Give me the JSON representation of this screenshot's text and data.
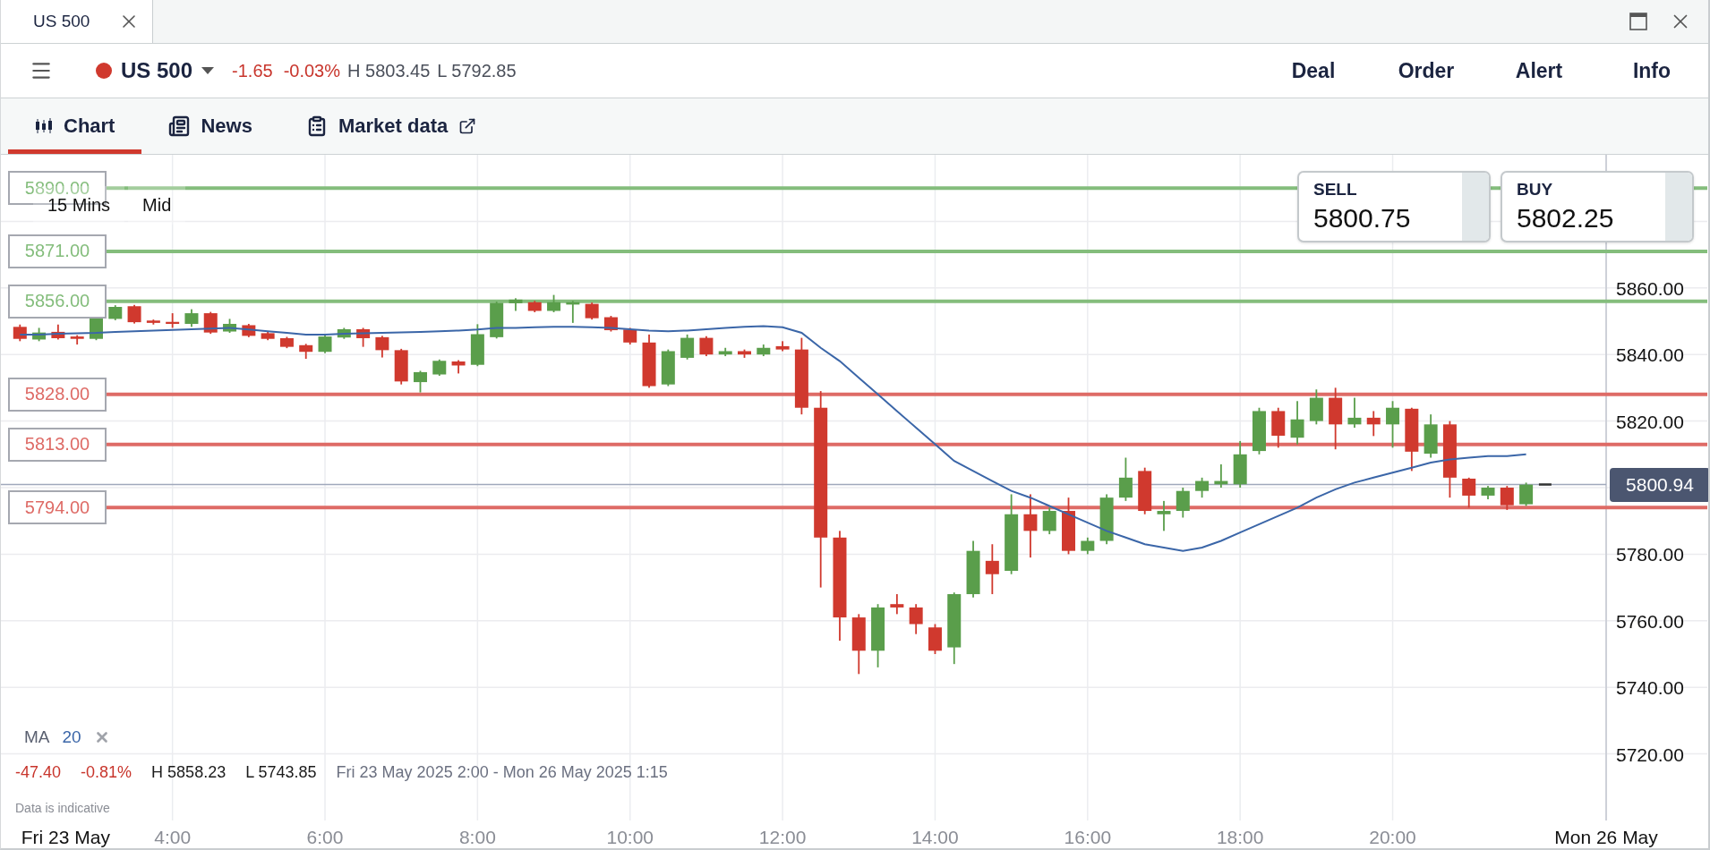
{
  "window": {
    "tab_title": "US 500"
  },
  "instrument": {
    "name": "US 500",
    "change": "-1.65",
    "change_pct": "-0.03%",
    "high": "H 5803.45",
    "low": "L 5792.85"
  },
  "actions": [
    "Deal",
    "Order",
    "Alert",
    "Info"
  ],
  "tabs": [
    {
      "label": "Chart",
      "selected": true,
      "kind": "chart",
      "external": false
    },
    {
      "label": "News",
      "selected": false,
      "kind": "news",
      "external": false
    },
    {
      "label": "Market data",
      "selected": false,
      "kind": "market",
      "external": true
    }
  ],
  "chart": {
    "interval": "15 Mins",
    "price_type": "Mid",
    "sell": {
      "label": "SELL",
      "price": "5800.75"
    },
    "buy": {
      "label": "BUY",
      "price": "5802.25"
    },
    "indicator_name": "MA",
    "stats": {
      "change": "-47.40",
      "change_pct": "-0.81%",
      "high": "H 5858.23",
      "low": "L 5743.85",
      "range": "Fri 23 May 2025 2:00 - Mon 26 May 2025 1:15"
    },
    "disclaimer": "Data is indicative",
    "chart_data": {
      "type": "candlestick",
      "grid": true,
      "xlim": [
        1.75,
        22.8
      ],
      "ylim": [
        5700,
        5900
      ],
      "yticks": [
        {
          "value": 5720,
          "label": "5720.00"
        },
        {
          "value": 5740,
          "label": "5740.00"
        },
        {
          "value": 5760,
          "label": "5760.00"
        },
        {
          "value": 5780,
          "label": "5780.00"
        },
        {
          "value": 5820,
          "label": "5820.00"
        },
        {
          "value": 5840,
          "label": "5840.00"
        },
        {
          "value": 5860,
          "label": "5860.00"
        }
      ],
      "xticks": [
        {
          "value": 2.6,
          "label": "Fri 23 May"
        },
        {
          "value": 4,
          "label": "4:00"
        },
        {
          "value": 6,
          "label": "6:00"
        },
        {
          "value": 8,
          "label": "8:00"
        },
        {
          "value": 10,
          "label": "10:00"
        },
        {
          "value": 12,
          "label": "12:00"
        },
        {
          "value": 14,
          "label": "14:00"
        },
        {
          "value": 16,
          "label": "16:00"
        },
        {
          "value": 18,
          "label": "18:00"
        },
        {
          "value": 20,
          "label": "20:00"
        },
        {
          "value": 22.8,
          "label": "Mon 26 May"
        }
      ],
      "x": [
        2,
        2.25,
        2.5,
        2.75,
        3,
        3.25,
        3.5,
        3.75,
        4,
        4.25,
        4.5,
        4.75,
        5,
        5.25,
        5.5,
        5.75,
        6,
        6.25,
        6.5,
        6.75,
        7,
        7.25,
        7.5,
        7.75,
        8,
        8.25,
        8.5,
        8.75,
        9,
        9.25,
        9.5,
        9.75,
        10,
        10.25,
        10.5,
        10.75,
        11,
        11.25,
        11.5,
        11.75,
        12,
        12.25,
        12.5,
        12.75,
        13,
        13.25,
        13.5,
        13.75,
        14,
        14.25,
        14.5,
        14.75,
        15,
        15.25,
        15.5,
        15.75,
        16,
        16.25,
        16.5,
        16.75,
        17,
        17.25,
        17.5,
        17.75,
        18,
        18.25,
        18.5,
        18.75,
        19,
        19.25,
        19.5,
        19.75,
        20,
        20.25,
        20.5,
        20.75,
        21,
        21.25,
        21.5,
        21.75
      ],
      "ohlc": [
        [
          5848.3,
          5849,
          5844,
          5844.7
        ],
        [
          5844.5,
          5848,
          5844,
          5846.6
        ],
        [
          5846.8,
          5849,
          5844.5,
          5844.9
        ],
        [
          5845.4,
          5845.8,
          5843,
          5844.7
        ],
        [
          5844.7,
          5851.3,
          5844.3,
          5851
        ],
        [
          5850.7,
          5854.8,
          5850.3,
          5854.3
        ],
        [
          5854.5,
          5854.9,
          5849.3,
          5849.7
        ],
        [
          5850.2,
          5850.5,
          5849,
          5849.5
        ],
        [
          5849.8,
          5852.4,
          5848,
          5849.2
        ],
        [
          5849.2,
          5853.6,
          5848.3,
          5852.4
        ],
        [
          5852.4,
          5852.8,
          5846.2,
          5846.6
        ],
        [
          5846.9,
          5850.7,
          5846.5,
          5849.2
        ],
        [
          5848.8,
          5849.2,
          5845.2,
          5845.6
        ],
        [
          5846.4,
          5846.8,
          5844.3,
          5844.7
        ],
        [
          5844.9,
          5845.3,
          5841.9,
          5842.3
        ],
        [
          5842.8,
          5843.2,
          5838.7,
          5840.8
        ],
        [
          5840.8,
          5845.8,
          5840.4,
          5845.4
        ],
        [
          5845.1,
          5848,
          5844.7,
          5847.6
        ],
        [
          5847.6,
          5848,
          5842.3,
          5844.9
        ],
        [
          5845.2,
          5845.6,
          5839.1,
          5841.3
        ],
        [
          5841.3,
          5841.7,
          5831,
          5831.9
        ],
        [
          5831.7,
          5835.1,
          5828.6,
          5834.7
        ],
        [
          5834,
          5838.5,
          5833.6,
          5838.1
        ],
        [
          5837.9,
          5838.3,
          5834.3,
          5836.7
        ],
        [
          5836.9,
          5849.1,
          5836.5,
          5846.1
        ],
        [
          5845.2,
          5855.9,
          5844.8,
          5855.5
        ],
        [
          5855.4,
          5856.9,
          5853.1,
          5856.5
        ],
        [
          5855.7,
          5856.1,
          5852.7,
          5853.1
        ],
        [
          5853.1,
          5857.9,
          5852.7,
          5855.7
        ],
        [
          5855,
          5856.1,
          5849.5,
          5855.7
        ],
        [
          5855.2,
          5855.6,
          5850.5,
          5850.9
        ],
        [
          5851.2,
          5851.6,
          5846.9,
          5847.3
        ],
        [
          5847.5,
          5848,
          5843,
          5843.6
        ],
        [
          5843.6,
          5846,
          5830,
          5830.5
        ],
        [
          5831,
          5841.5,
          5830.5,
          5841
        ],
        [
          5839,
          5846,
          5838.5,
          5845
        ],
        [
          5845,
          5845.5,
          5839.5,
          5840
        ],
        [
          5840,
          5842,
          5839.5,
          5841
        ],
        [
          5841,
          5841.5,
          5839,
          5840
        ],
        [
          5840,
          5843,
          5839.5,
          5842
        ],
        [
          5842.5,
          5844,
          5841,
          5841.5
        ],
        [
          5841.5,
          5845,
          5822,
          5824
        ],
        [
          5824,
          5829,
          5770,
          5785
        ],
        [
          5785,
          5787,
          5754,
          5761
        ],
        [
          5761,
          5762,
          5744,
          5751
        ],
        [
          5751,
          5765,
          5746,
          5764
        ],
        [
          5765,
          5768,
          5762,
          5764
        ],
        [
          5764,
          5765,
          5756,
          5759
        ],
        [
          5758,
          5759,
          5750,
          5751
        ],
        [
          5752,
          5768.5,
          5747,
          5768
        ],
        [
          5768,
          5784,
          5767,
          5781
        ],
        [
          5778,
          5783,
          5768,
          5774
        ],
        [
          5775,
          5798,
          5774,
          5792
        ],
        [
          5792,
          5798,
          5779,
          5787
        ],
        [
          5787,
          5794,
          5786,
          5793
        ],
        [
          5793,
          5797,
          5780,
          5781
        ],
        [
          5781,
          5785,
          5780,
          5784
        ],
        [
          5784,
          5798,
          5783,
          5797
        ],
        [
          5797,
          5809,
          5796,
          5803
        ],
        [
          5805,
          5806,
          5792,
          5793
        ],
        [
          5792,
          5796,
          5787,
          5793
        ],
        [
          5793,
          5800,
          5791,
          5799
        ],
        [
          5799,
          5803,
          5797,
          5802
        ],
        [
          5801,
          5807,
          5800,
          5802
        ],
        [
          5801,
          5814,
          5800,
          5810
        ],
        [
          5811,
          5824,
          5810,
          5823
        ],
        [
          5823,
          5824,
          5812,
          5815.6
        ],
        [
          5815,
          5826,
          5813,
          5820.5
        ],
        [
          5820,
          5829.5,
          5819,
          5827
        ],
        [
          5827,
          5830,
          5811.5,
          5819
        ],
        [
          5819,
          5827,
          5818,
          5821
        ],
        [
          5821,
          5823,
          5815.5,
          5819
        ],
        [
          5819,
          5826,
          5812,
          5824
        ],
        [
          5823.7,
          5824,
          5805,
          5810.8
        ],
        [
          5810.2,
          5822,
          5809,
          5819
        ],
        [
          5819,
          5820,
          5797,
          5803
        ],
        [
          5802.7,
          5803,
          5794,
          5797.6
        ],
        [
          5797.6,
          5800.5,
          5796.5,
          5800
        ],
        [
          5800,
          5800.5,
          5793.3,
          5794.7
        ],
        [
          5795,
          5801.5,
          5794.5,
          5800.9
        ]
      ],
      "series": [
        {
          "name": "20",
          "type": "line",
          "color": "#3b66a8",
          "values": [
            5846,
            5846,
            5846.2,
            5846.4,
            5846.5,
            5846.8,
            5847,
            5847.2,
            5847.4,
            5847.6,
            5847.8,
            5848,
            5847.5,
            5847,
            5846.5,
            5846,
            5846,
            5846.2,
            5846.4,
            5846.5,
            5846.6,
            5846.8,
            5847,
            5847.2,
            5847.5,
            5848,
            5848,
            5848.2,
            5848.3,
            5848.3,
            5848.2,
            5848,
            5847.6,
            5847.2,
            5847,
            5847.2,
            5847.6,
            5848,
            5848.3,
            5848.5,
            5848.2,
            5846.5,
            5842,
            5838,
            5833,
            5828,
            5823,
            5818,
            5813,
            5808,
            5805,
            5802,
            5799,
            5797,
            5794.5,
            5792,
            5789.5,
            5787,
            5785,
            5783,
            5782,
            5781,
            5782,
            5784,
            5786.5,
            5789,
            5791.5,
            5794,
            5797,
            5799.5,
            5801.5,
            5803,
            5804.5,
            5806,
            5807.5,
            5808.5,
            5809,
            5809.5,
            5809.5,
            5810
          ]
        }
      ],
      "ref_lines": [
        {
          "axis": "y",
          "value": 5890,
          "label": "5890.00",
          "color": "#84bd7c"
        },
        {
          "axis": "y",
          "value": 5871,
          "label": "5871.00",
          "color": "#84bd7c"
        },
        {
          "axis": "y",
          "value": 5856,
          "label": "5856.00",
          "color": "#84bd7c"
        },
        {
          "axis": "y",
          "value": 5828,
          "label": "5828.00",
          "color": "#de6b66"
        },
        {
          "axis": "y",
          "value": 5813,
          "label": "5813.00",
          "color": "#de6b66"
        },
        {
          "axis": "y",
          "value": 5794,
          "label": "5794.00",
          "color": "#de6b66"
        },
        {
          "axis": "y",
          "value": 5800.94,
          "color": "#a0a8bb"
        }
      ],
      "annotations": [
        "5800.94"
      ]
    }
  }
}
